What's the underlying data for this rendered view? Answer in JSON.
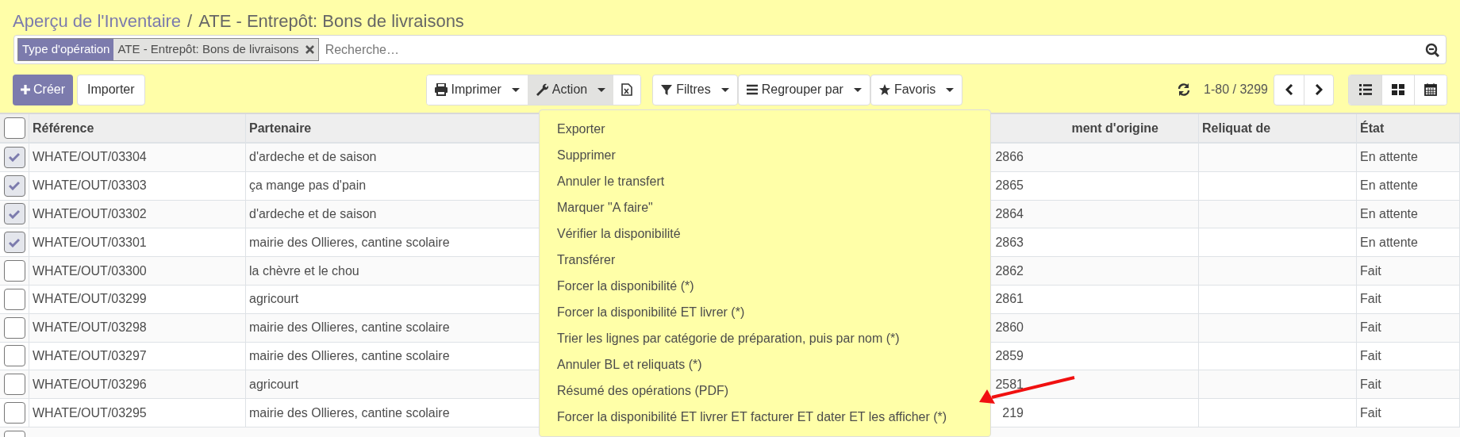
{
  "breadcrumb": {
    "items": [
      {
        "label": "Aperçu de l'Inventaire",
        "kind": "link"
      },
      {
        "label": "ATE - Entrepôt: Bons de livraisons",
        "kind": "current"
      }
    ],
    "separator": "/"
  },
  "search": {
    "facets": [
      {
        "label": "Type d'opération",
        "value": "ATE - Entrepôt: Bons de livraisons"
      }
    ],
    "placeholder": "Recherche…"
  },
  "buttons": [
    {
      "label": "Créer",
      "kind": "primary"
    },
    {
      "label": "Importer",
      "kind": "secondary"
    }
  ],
  "action_buttons": [
    {
      "kind": "dropdown",
      "label": "Imprimer",
      "selected": false
    },
    {
      "kind": "dropdown",
      "label": "Action",
      "selected": true
    },
    {
      "kind": "icon",
      "selected": false
    }
  ],
  "search_buttons": [
    {
      "label": "Filtres"
    },
    {
      "label": "Regrouper par"
    },
    {
      "label": "Favoris"
    }
  ],
  "pager": {
    "range": "1-80 / 3299"
  },
  "views": [
    {
      "selected": true
    },
    {
      "selected": false
    },
    {
      "selected": false
    }
  ],
  "table": {
    "header_checked": false,
    "partial_row": {
      "checked": false
    },
    "columns": [
      "Référence",
      "Partenaire",
      "ment d'origine",
      "Reliquat de",
      "État"
    ],
    "rows": [
      {
        "checked": true,
        "cells": [
          "WHATE/OUT/03304",
          "d'ardeche et de saison",
          "2866",
          "",
          "En attente"
        ]
      },
      {
        "checked": true,
        "cells": [
          "WHATE/OUT/03303",
          "ça mange pas d'pain",
          "2865",
          "",
          "En attente"
        ]
      },
      {
        "checked": true,
        "cells": [
          "WHATE/OUT/03302",
          "d'ardeche et de saison",
          "2864",
          "",
          "En attente"
        ]
      },
      {
        "checked": true,
        "cells": [
          "WHATE/OUT/03301",
          "mairie des Ollieres, cantine scolaire",
          "2863",
          "",
          "En attente"
        ]
      },
      {
        "checked": false,
        "cells": [
          "WHATE/OUT/03300",
          "la chèvre et le chou",
          "2862",
          "",
          "Fait"
        ]
      },
      {
        "checked": false,
        "cells": [
          "WHATE/OUT/03299",
          "agricourt",
          "2861",
          "",
          "Fait"
        ]
      },
      {
        "checked": false,
        "cells": [
          "WHATE/OUT/03298",
          "mairie des Ollieres, cantine scolaire",
          "2860",
          "",
          "Fait"
        ]
      },
      {
        "checked": false,
        "cells": [
          "WHATE/OUT/03297",
          "mairie des Ollieres, cantine scolaire",
          "2859",
          "",
          "Fait"
        ]
      },
      {
        "checked": false,
        "cells": [
          "WHATE/OUT/03296",
          "agricourt",
          "2581",
          "",
          "Fait"
        ]
      },
      {
        "checked": false,
        "cells": [
          "WHATE/OUT/03295",
          "mairie des Ollieres, cantine scolaire",
          "219",
          "",
          "Fait"
        ]
      }
    ]
  },
  "action_menu": {
    "items": [
      "Exporter",
      "Supprimer",
      "Annuler le transfert",
      "Marquer \"A faire\"",
      "Vérifier la disponibilité",
      "Transférer",
      "Forcer la disponibilité (*)",
      "Forcer la disponibilité ET livrer (*)",
      "Trier les lignes par catégorie de préparation, puis par nom (*)",
      "Annuler BL et reliquats (*)",
      "Résumé des opérations (PDF)",
      "Forcer la disponibilité ET livrer ET facturer ET dater ET les afficher (*)"
    ]
  }
}
